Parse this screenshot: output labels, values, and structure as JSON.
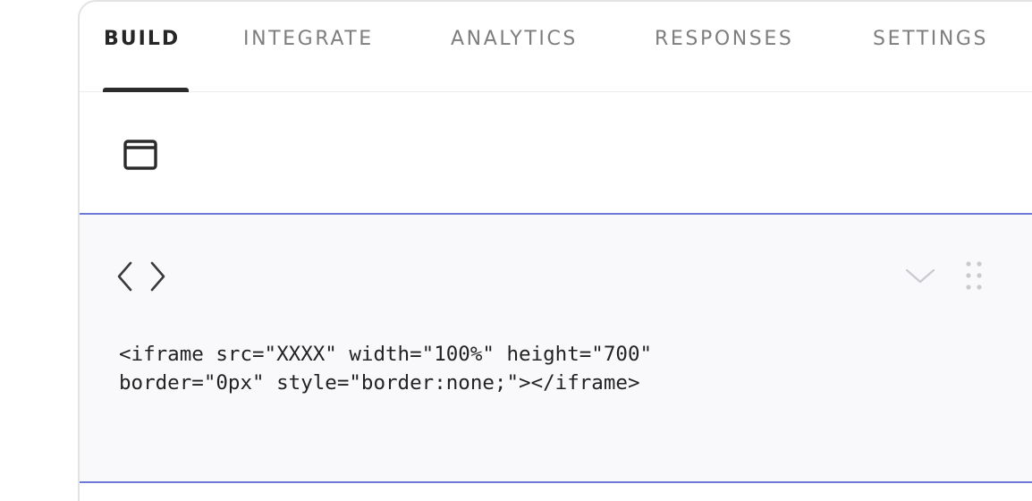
{
  "tabs": [
    {
      "label": "BUILD",
      "active": true
    },
    {
      "label": "INTEGRATE",
      "active": false
    },
    {
      "label": "ANALYTICS",
      "active": false
    },
    {
      "label": "RESPONSES",
      "active": false
    },
    {
      "label": "SETTINGS",
      "active": false
    }
  ],
  "toolbar": {
    "icon": "window-icon"
  },
  "embed_block": {
    "icon": "code-icon",
    "collapse_icon": "chevron-down-icon",
    "drag_icon": "drag-handle-icon",
    "code_line_1": "<iframe src=\"XXXX\" width=\"100%\" height=\"700\"",
    "code_line_2": "border=\"0px\" style=\"border:none;\"></iframe>"
  },
  "colors": {
    "accent_border": "#6f79d8",
    "active_tab": "#262626",
    "inactive_tab": "#7e7e7e",
    "block_background": "#f9f9fb"
  }
}
